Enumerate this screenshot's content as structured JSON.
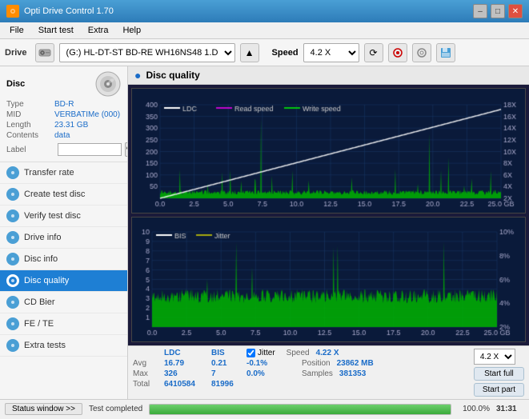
{
  "window": {
    "title": "Opti Drive Control 1.70",
    "icon": "ODC"
  },
  "titlebar": {
    "minimize": "–",
    "maximize": "□",
    "close": "✕"
  },
  "menu": {
    "items": [
      "File",
      "Start test",
      "Extra",
      "Help"
    ]
  },
  "toolbar": {
    "drive_label": "Drive",
    "drive_value": "(G:)  HL-DT-ST BD-RE  WH16NS48 1.D3",
    "speed_label": "Speed",
    "speed_value": "4.2 X"
  },
  "disc": {
    "title": "Disc",
    "type_label": "Type",
    "type_value": "BD-R",
    "mid_label": "MID",
    "mid_value": "VERBATIMe (000)",
    "length_label": "Length",
    "length_value": "23.31 GB",
    "contents_label": "Contents",
    "contents_value": "data",
    "label_label": "Label",
    "label_value": ""
  },
  "nav": {
    "items": [
      {
        "id": "transfer-rate",
        "label": "Transfer rate",
        "active": false
      },
      {
        "id": "create-test-disc",
        "label": "Create test disc",
        "active": false
      },
      {
        "id": "verify-test-disc",
        "label": "Verify test disc",
        "active": false
      },
      {
        "id": "drive-info",
        "label": "Drive info",
        "active": false
      },
      {
        "id": "disc-info",
        "label": "Disc info",
        "active": false
      },
      {
        "id": "disc-quality",
        "label": "Disc quality",
        "active": true
      },
      {
        "id": "cd-bier",
        "label": "CD Bier",
        "active": false
      },
      {
        "id": "fe-te",
        "label": "FE / TE",
        "active": false
      },
      {
        "id": "extra-tests",
        "label": "Extra tests",
        "active": false
      }
    ]
  },
  "chart": {
    "title": "Disc quality",
    "legend_top": [
      {
        "label": "LDC",
        "color": "#ffffff"
      },
      {
        "label": "Read speed",
        "color": "#ff00ff"
      },
      {
        "label": "Write speed",
        "color": "#00ff00"
      }
    ],
    "legend_bottom": [
      {
        "label": "BIS",
        "color": "#ffffff"
      },
      {
        "label": "Jitter",
        "color": "#ffff00"
      }
    ],
    "top_ymax": 400,
    "top_ymarks": [
      400,
      350,
      300,
      250,
      200,
      150,
      100,
      50
    ],
    "top_ymarks_right": [
      "18X",
      "16X",
      "14X",
      "12X",
      "10X",
      "8X",
      "6X",
      "4X",
      "2X"
    ],
    "bottom_ymax": 10,
    "xmax": 25,
    "xmarks": [
      0.0,
      2.5,
      5.0,
      7.5,
      10.0,
      12.5,
      15.0,
      17.5,
      20.0,
      22.5,
      25.0
    ]
  },
  "stats": {
    "ldc_label": "LDC",
    "bis_label": "BIS",
    "jitter_label": "Jitter",
    "speed_label": "Speed",
    "position_label": "Position",
    "samples_label": "Samples",
    "avg_label": "Avg",
    "avg_ldc": "16.79",
    "avg_bis": "0.21",
    "avg_jitter": "-0.1%",
    "max_label": "Max",
    "max_ldc": "326",
    "max_bis": "7",
    "max_jitter": "0.0%",
    "total_label": "Total",
    "total_ldc": "6410584",
    "total_bis": "81996",
    "speed_val": "4.22 X",
    "position_val": "23862 MB",
    "samples_val": "381353",
    "speed_select": "4.2 X",
    "start_full": "Start full",
    "start_part": "Start part",
    "jitter_checked": true
  },
  "statusbar": {
    "status_btn_label": "Status window >>",
    "progress_pct": 100,
    "progress_label": "100.0%",
    "time_label": "31:31",
    "status_text": "Test completed"
  }
}
